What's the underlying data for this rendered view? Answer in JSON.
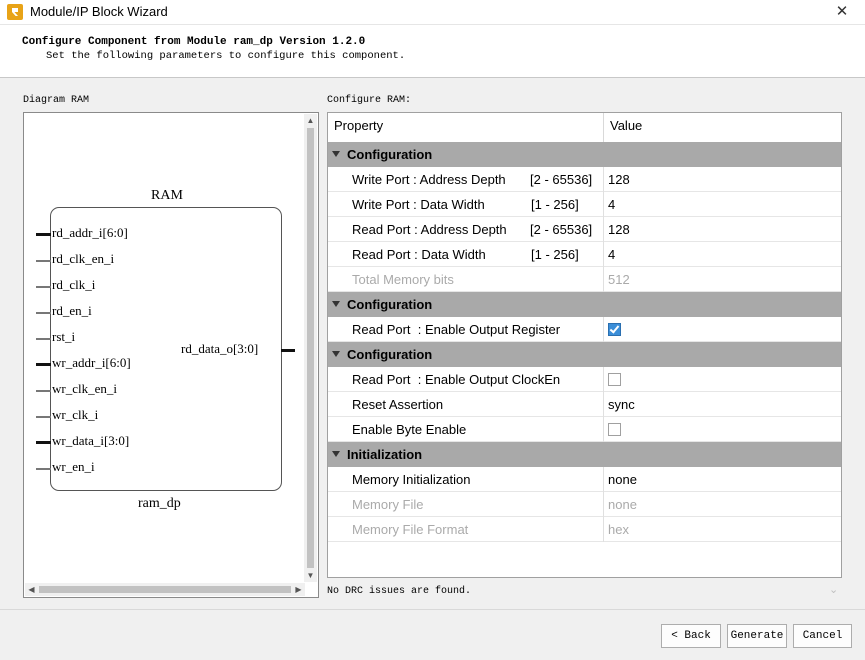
{
  "window": {
    "title": "Module/IP Block Wizard",
    "close_glyph": "✕"
  },
  "header": {
    "title": "Configure Component from Module ram_dp Version 1.2.0",
    "subtitle": "Set the following parameters to configure this component."
  },
  "diagram": {
    "label": "Diagram RAM",
    "block_title": "RAM",
    "block_name": "ram_dp",
    "left_ports": [
      {
        "name": "rd_addr_i[6:0]",
        "bus": true
      },
      {
        "name": "rd_clk_en_i",
        "bus": false
      },
      {
        "name": "rd_clk_i",
        "bus": false
      },
      {
        "name": "rd_en_i",
        "bus": false
      },
      {
        "name": "rst_i",
        "bus": false
      },
      {
        "name": "wr_addr_i[6:0]",
        "bus": true
      },
      {
        "name": "wr_clk_en_i",
        "bus": false
      },
      {
        "name": "wr_clk_i",
        "bus": false
      },
      {
        "name": "wr_data_i[3:0]",
        "bus": true
      },
      {
        "name": "wr_en_i",
        "bus": false
      }
    ],
    "right_ports": [
      {
        "name": "rd_data_o[3:0]",
        "bus": true
      }
    ]
  },
  "config": {
    "label": "Configure RAM:",
    "columns": {
      "property": "Property",
      "value": "Value"
    },
    "groups": [
      {
        "label": "Configuration",
        "rows": [
          {
            "name": "Write Port : Address Depth",
            "range": "[2 - 65536]",
            "value": "128",
            "type": "text",
            "disabled": false
          },
          {
            "name": "Write Port : Data Width",
            "range": "[1 - 256]",
            "value": "4",
            "type": "text",
            "disabled": false
          },
          {
            "name": "Read Port : Address Depth",
            "range": "[2 - 65536]",
            "value": "128",
            "type": "text",
            "disabled": false
          },
          {
            "name": "Read Port : Data Width",
            "range": "[1 - 256]",
            "value": "4",
            "type": "text",
            "disabled": false
          },
          {
            "name": "Total Memory bits",
            "range": "",
            "value": "512",
            "type": "text",
            "disabled": true
          }
        ]
      },
      {
        "label": "Configuration",
        "rows": [
          {
            "name": "Read Port  : Enable Output Register",
            "range": "",
            "value": "",
            "checked": true,
            "type": "checkbox",
            "disabled": false
          }
        ]
      },
      {
        "label": "Configuration",
        "rows": [
          {
            "name": "Read Port  : Enable Output ClockEn",
            "range": "",
            "value": "",
            "checked": false,
            "type": "checkbox",
            "disabled": false
          },
          {
            "name": "Reset Assertion",
            "range": "",
            "value": "sync",
            "type": "text",
            "disabled": false
          },
          {
            "name": "Enable Byte Enable",
            "range": "",
            "value": "",
            "checked": false,
            "type": "checkbox",
            "disabled": false
          }
        ]
      },
      {
        "label": "Initialization",
        "rows": [
          {
            "name": "Memory Initialization",
            "range": "",
            "value": "none",
            "type": "text",
            "disabled": false
          },
          {
            "name": "Memory File",
            "range": "",
            "value": "none",
            "type": "text",
            "disabled": true
          },
          {
            "name": "Memory File Format",
            "range": "",
            "value": "hex",
            "type": "text",
            "disabled": true
          }
        ]
      }
    ]
  },
  "status": {
    "drc_message": "No DRC issues are found."
  },
  "buttons": {
    "back": "< Back",
    "generate": "Generate",
    "cancel": "Cancel"
  },
  "colors": {
    "group_header": "#a9a9a9",
    "checkbox_checked": "#3b8ed8",
    "app_icon": "#e8a317"
  }
}
